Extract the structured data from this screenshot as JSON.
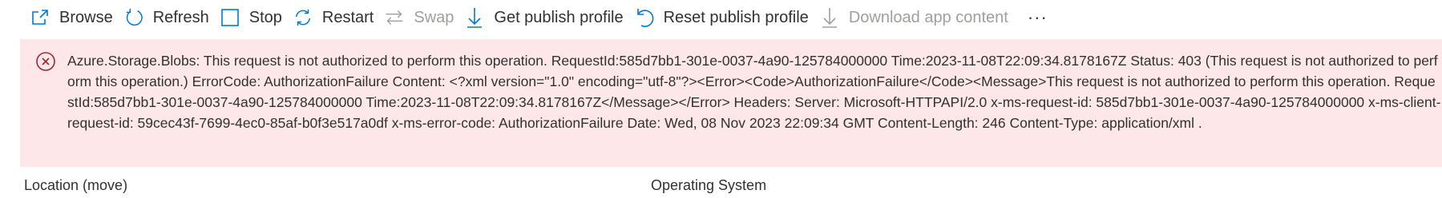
{
  "toolbar": {
    "browse": "Browse",
    "refresh": "Refresh",
    "stop": "Stop",
    "restart": "Restart",
    "swap": "Swap",
    "get_publish_profile": "Get publish profile",
    "reset_publish_profile": "Reset publish profile",
    "download_app_content": "Download app content",
    "more": "···"
  },
  "colors": {
    "accent": "#0078d4",
    "error_bg": "#fde7e9",
    "error_icon": "#a4262c",
    "disabled": "#a19f9d"
  },
  "error": {
    "message": "Azure.Storage.Blobs: This request is not authorized to perform this operation. RequestId:585d7bb1-301e-0037-4a90-125784000000 Time:2023-11-08T22:09:34.8178167Z Status: 403 (This request is not authorized to perform this operation.) ErrorCode: AuthorizationFailure Content: <?xml version=\"1.0\" encoding=\"utf-8\"?><Error><Code>AuthorizationFailure</Code><Message>This request is not authorized to perform this operation. RequestId:585d7bb1-301e-0037-4a90-125784000000 Time:2023-11-08T22:09:34.8178167Z</Message></Error> Headers: Server: Microsoft-HTTPAPI/2.0 x-ms-request-id: 585d7bb1-301e-0037-4a90-125784000000 x-ms-client-request-id: 59cec43f-7699-4ec0-85af-b0f3e517a0df x-ms-error-code: AuthorizationFailure Date: Wed, 08 Nov 2023 22:09:34 GMT Content-Length: 246 Content-Type: application/xml ."
  },
  "behind": {
    "left": "Location (move)",
    "right": "Operating System"
  }
}
